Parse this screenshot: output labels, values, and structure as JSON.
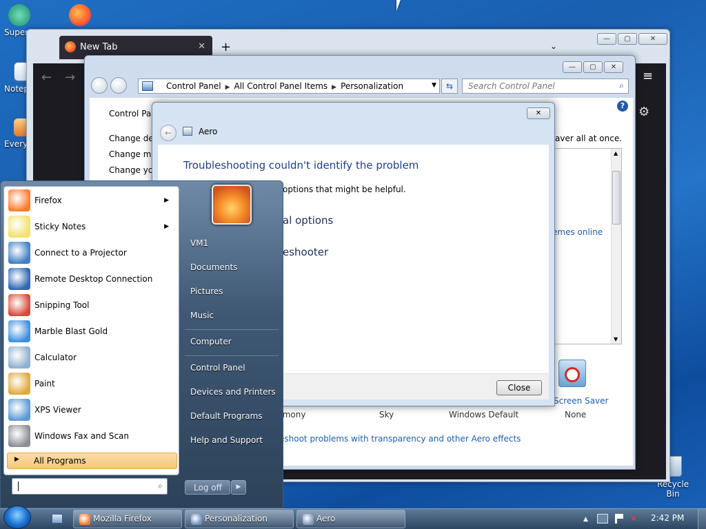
{
  "desktop": {
    "icons": [
      {
        "label": "Super"
      },
      {
        "label": "Notep"
      },
      {
        "label": "Every"
      }
    ],
    "recycle_bin": "Recycle Bin"
  },
  "firefox": {
    "tab_title": "New Tab",
    "tab_close": "✕",
    "new_tab": "+",
    "tab_list": "⌄",
    "back": "←",
    "forward": "→",
    "menu": "≡",
    "settings": "⚙"
  },
  "window_buttons": {
    "minimize": "—",
    "maximize": "▢",
    "close": "✕"
  },
  "control_panel": {
    "breadcrumb": [
      "Control Panel",
      "All Control Panel Items",
      "Personalization"
    ],
    "search_placeholder": "Search Control Panel",
    "help": "?",
    "sidebar": [
      "Control Pan",
      "Change des",
      "Change mo",
      "Change you"
    ],
    "intro_suffix": "aver all at once.",
    "themes_online": "emes online",
    "themes": [
      "rmony",
      "Sky",
      "Windows Default",
      "None"
    ],
    "screen_saver_label": "Screen Saver",
    "troubleshoot_link": "eshoot problems with transparency and other Aero effects"
  },
  "dialog": {
    "title": "Aero",
    "heading": "Troubleshooting couldn't identify the problem",
    "body_text": "options that might be helpful.",
    "option1": "al options",
    "option2": "eshooter",
    "close_label": "Close"
  },
  "start_menu": {
    "programs": [
      {
        "label": "Firefox",
        "arrow": true,
        "color": "#ff7a2e"
      },
      {
        "label": "Sticky Notes",
        "arrow": true,
        "color": "#f2e26b"
      },
      {
        "label": "Connect to a Projector",
        "arrow": false,
        "color": "#3f7fc4"
      },
      {
        "label": "Remote Desktop Connection",
        "arrow": false,
        "color": "#2e68b5"
      },
      {
        "label": "Snipping Tool",
        "arrow": false,
        "color": "#d84a3a"
      },
      {
        "label": "Marble Blast Gold",
        "arrow": false,
        "color": "#3d8ee0"
      },
      {
        "label": "Calculator",
        "arrow": false,
        "color": "#8fb0cf"
      },
      {
        "label": "Paint",
        "arrow": false,
        "color": "#e0a93b"
      },
      {
        "label": "XPS Viewer",
        "arrow": false,
        "color": "#5a9ad6"
      },
      {
        "label": "Windows Fax and Scan",
        "arrow": false,
        "color": "#8a8f96"
      }
    ],
    "all_programs": "All Programs",
    "right_items": [
      "VM1",
      "Documents",
      "Pictures",
      "Music",
      "Computer",
      "Control Panel",
      "Devices and Printers",
      "Default Programs",
      "Help and Support"
    ],
    "log_off": "Log off",
    "search_icon": "⌕"
  },
  "taskbar": {
    "buttons": [
      {
        "label": "Mozilla Firefox",
        "color": "#ff7a2e"
      },
      {
        "label": "Personalization",
        "color": "#6f8fc4"
      },
      {
        "label": "Aero",
        "color": "#7f97b8"
      }
    ],
    "clock": "2:42 PM",
    "tray_up": "▲"
  },
  "colors": {
    "dialog_heading": "#1a3f8c",
    "link": "#1b5fb0",
    "all_programs_bg": "#f6c97a"
  }
}
